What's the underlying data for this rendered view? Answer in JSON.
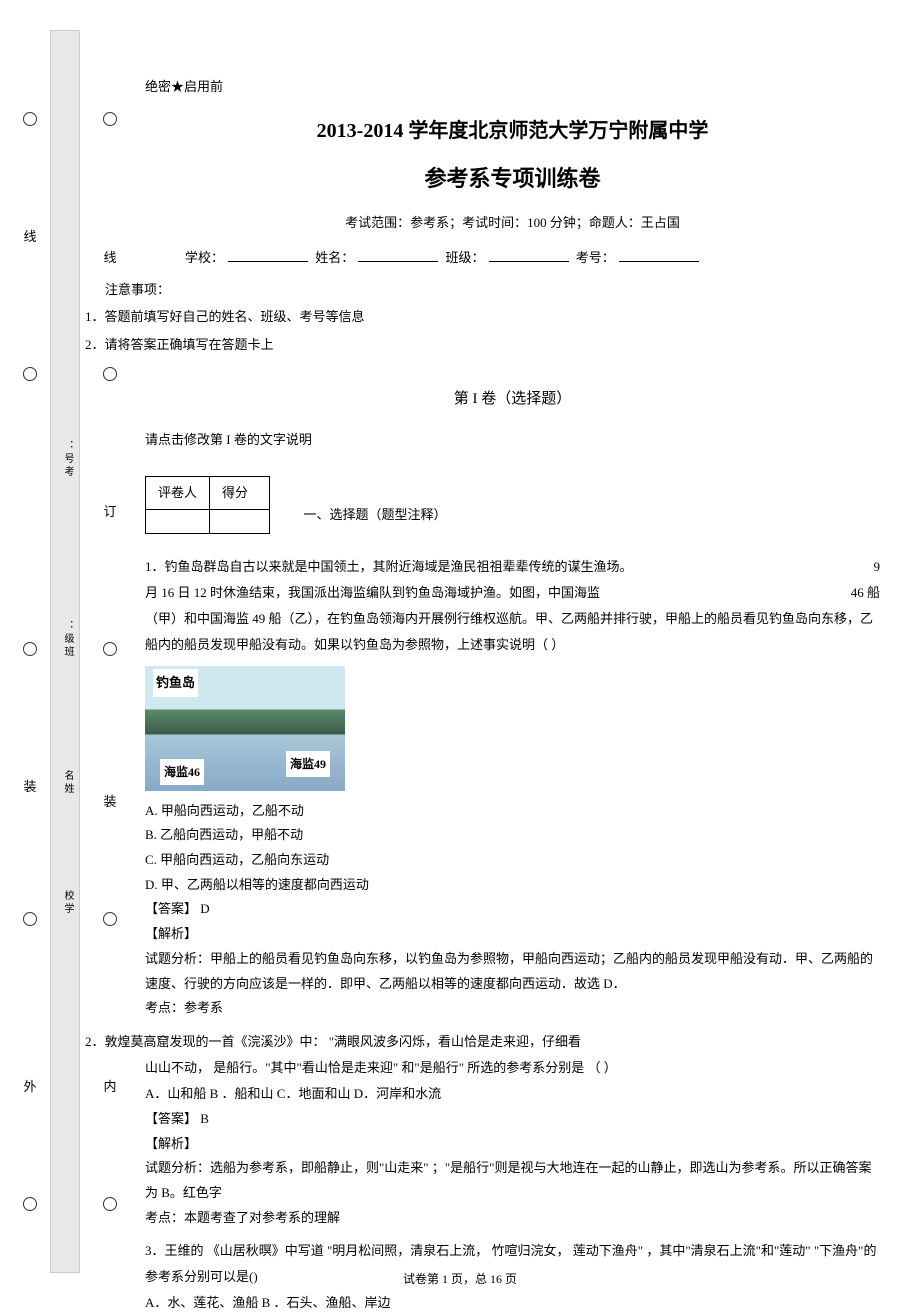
{
  "secrecy": "绝密★启用前",
  "title_main": "2013-2014 学年度北京师范大学万宁附属中学",
  "title_sub": "参考系专项训练卷",
  "exam_info": "考试范围：参考系；考试时间：100 分钟；命题人：王占国",
  "fill_labels": {
    "school": "学校：",
    "name": "姓名：",
    "class": "班级：",
    "number": "考号："
  },
  "notice_header": "注意事项：",
  "notice_1": "1．答题前填写好自己的姓名、班级、考号等信息",
  "notice_2": "2．请将答案正确填写在答题卡上",
  "section_title": "第 I 卷（选择题）",
  "instruction": "请点击修改第   I 卷的文字说明",
  "score_header_1": "评卷人",
  "score_header_2": "得分",
  "section_type": "一、选择题（题型注释）",
  "q1_text_1": "1．钓鱼岛群岛自古以来就是中国领土，其附近海域是渔民祖祖辈辈传统的谋生渔场。",
  "q1_text_1_tail": "9",
  "q1_text_2": "月 16 日 12 时休渔结束，我国派出海监编队到钓鱼岛海域护渔。如图，中国海监",
  "q1_text_2_tail": "46 船",
  "q1_text_3": "（甲）和中国海监   49 船（乙），在钓鱼岛领海内开展例行维权巡航。甲、乙两船并排行驶，甲船上的船员看见钓鱼岛向东移，乙船内的船员发现甲船没有动。如果以钓鱼岛为参照物，上述事实说明（         ）",
  "img_labels": {
    "island": "钓鱼岛",
    "ship49": "海监49",
    "ship46": "海监46"
  },
  "q1_opts": {
    "a": "A. 甲船向西运动，乙船不动",
    "b": "B. 乙船向西运动，甲船不动",
    "c": "C. 甲船向西运动，乙船向东运动",
    "d": "D. 甲、乙两船以相等的速度都向西运动"
  },
  "q1_ans": "【答案】 D",
  "q1_exp_h": "【解析】",
  "q1_exp_1": "试题分析：甲船上的船员看见钓鱼岛向东移，以钓鱼岛为参照物，甲船向西运动；乙船内的船员发现甲船没有动．甲、乙两船的速度、行驶的方向应该是一样的．即甲、乙两船以相等的速度都向西运动．故选      D．",
  "q1_point": "考点：参考系",
  "q2_text_1": "2．敦煌莫高窟发现的一首《浣溪沙》中：   \"满眼风波多闪烁，看山恰是走来迎，仔细看",
  "q2_text_2": "山山不动，  是船行。\"其中\"看山恰是走来迎\"  和\"是船行\" 所选的参考系分别是  （     ）",
  "q2_opts": "A．山和船 B   ．船和山  C．地面和山    D．河岸和水流",
  "q2_ans": "【答案】 B",
  "q2_exp_h": "【解析】",
  "q2_exp_1": "试题分析：选船为参考系，即船静止，则\"山走来\"    ；\"是船行\"则是视与大地连在一起的山静止，即选山为参考系。所以正确答案为      B。红色字",
  "q2_point": "考点：本题考查了对参考系的理解",
  "q3_text_1": "3．王维的 《山居秋暝》中写道 \"明月松间照，清泉石上流，  竹喧归浣女，  莲动下渔舟\"  ，其中\"清泉石上流\"和\"莲动\"  \"下渔舟\"的参考系分别可以是()",
  "q3_opts": "A．水、莲花、渔船           B   ．石头、渔船、岸边",
  "footer": "试卷第 1 页，总 16  页",
  "margin": {
    "outer_labels": [
      "线",
      "装",
      "外"
    ],
    "inner_labels": [
      "线",
      "订",
      "装",
      "内"
    ],
    "vert_1": "：号考",
    "vert_2": "：级班",
    "vert_3": "名姓",
    "vert_4": "校学"
  }
}
